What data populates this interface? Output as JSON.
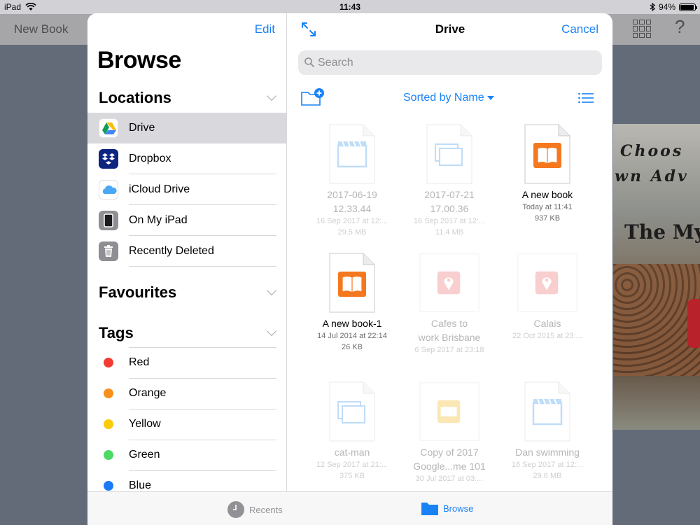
{
  "status_bar": {
    "device": "iPad",
    "time": "11:43",
    "battery": "94%",
    "battery_level": 0.94
  },
  "background_app": {
    "title": "New Book",
    "cover_text": [
      "Choos",
      "wn Adv",
      "The Mys"
    ]
  },
  "sidebar": {
    "edit_label": "Edit",
    "title": "Browse",
    "locations_header": "Locations",
    "locations": [
      {
        "label": "Drive",
        "icon": "google-drive-icon",
        "selected": true
      },
      {
        "label": "Dropbox",
        "icon": "dropbox-icon",
        "selected": false
      },
      {
        "label": "iCloud Drive",
        "icon": "icloud-icon",
        "selected": false
      },
      {
        "label": "On My iPad",
        "icon": "ipad-icon",
        "selected": false
      },
      {
        "label": "Recently Deleted",
        "icon": "trash-icon",
        "selected": false
      }
    ],
    "favourites_header": "Favourites",
    "tags_header": "Tags",
    "tags": [
      {
        "label": "Red",
        "color": "#f23c32"
      },
      {
        "label": "Orange",
        "color": "#f7911c"
      },
      {
        "label": "Yellow",
        "color": "#fbcb0a"
      },
      {
        "label": "Green",
        "color": "#4cd964"
      },
      {
        "label": "Blue",
        "color": "#1b7bf7"
      }
    ]
  },
  "main": {
    "title": "Drive",
    "cancel_label": "Cancel",
    "search_placeholder": "Search",
    "sort_label": "Sorted by Name",
    "files": [
      {
        "name_lines": [
          "2017-06-19",
          "12.33.44"
        ],
        "date": "16 Sep 2017 at 12:...",
        "size": "29.5 MB",
        "type": "video",
        "enabled": false
      },
      {
        "name_lines": [
          "2017-07-21",
          "17.00.36"
        ],
        "date": "16 Sep 2017 at 12:...",
        "size": "11.4 MB",
        "type": "images",
        "enabled": false
      },
      {
        "name_lines": [
          "A new book"
        ],
        "date": "Today at 11:41",
        "size": "937 KB",
        "type": "book",
        "enabled": true
      },
      {
        "name_lines": [
          "A new book-1"
        ],
        "date": "14 Jul 2014 at 22:14",
        "size": "26 KB",
        "type": "book",
        "enabled": true
      },
      {
        "name_lines": [
          "Cafes to",
          "work Brisbane"
        ],
        "date": "6 Sep 2017 at 23:18",
        "size": "",
        "type": "map",
        "enabled": false
      },
      {
        "name_lines": [
          "Calais"
        ],
        "date": "22 Oct 2015 at 23:...",
        "size": "",
        "type": "map",
        "enabled": false
      },
      {
        "name_lines": [
          "cat-man"
        ],
        "date": "12 Sep 2017 at 21:...",
        "size": "375 KB",
        "type": "images",
        "enabled": false
      },
      {
        "name_lines": [
          "Copy of 2017",
          "Google...me 101"
        ],
        "date": "30 Jul 2017 at 03:...",
        "size": "",
        "type": "slides",
        "enabled": false
      },
      {
        "name_lines": [
          "Dan swimming"
        ],
        "date": "16 Sep 2017 at 12:...",
        "size": "29.6 MB",
        "type": "video",
        "enabled": false
      }
    ]
  },
  "tabbar": {
    "recents_label": "Recents",
    "browse_label": "Browse",
    "active": "Browse"
  },
  "colors": {
    "accent": "#1982f6",
    "book_orange": "#f5781f",
    "video_blue": "#5aa8f0",
    "map_red": "#f08080",
    "slides_yellow": "#f2c23c"
  }
}
